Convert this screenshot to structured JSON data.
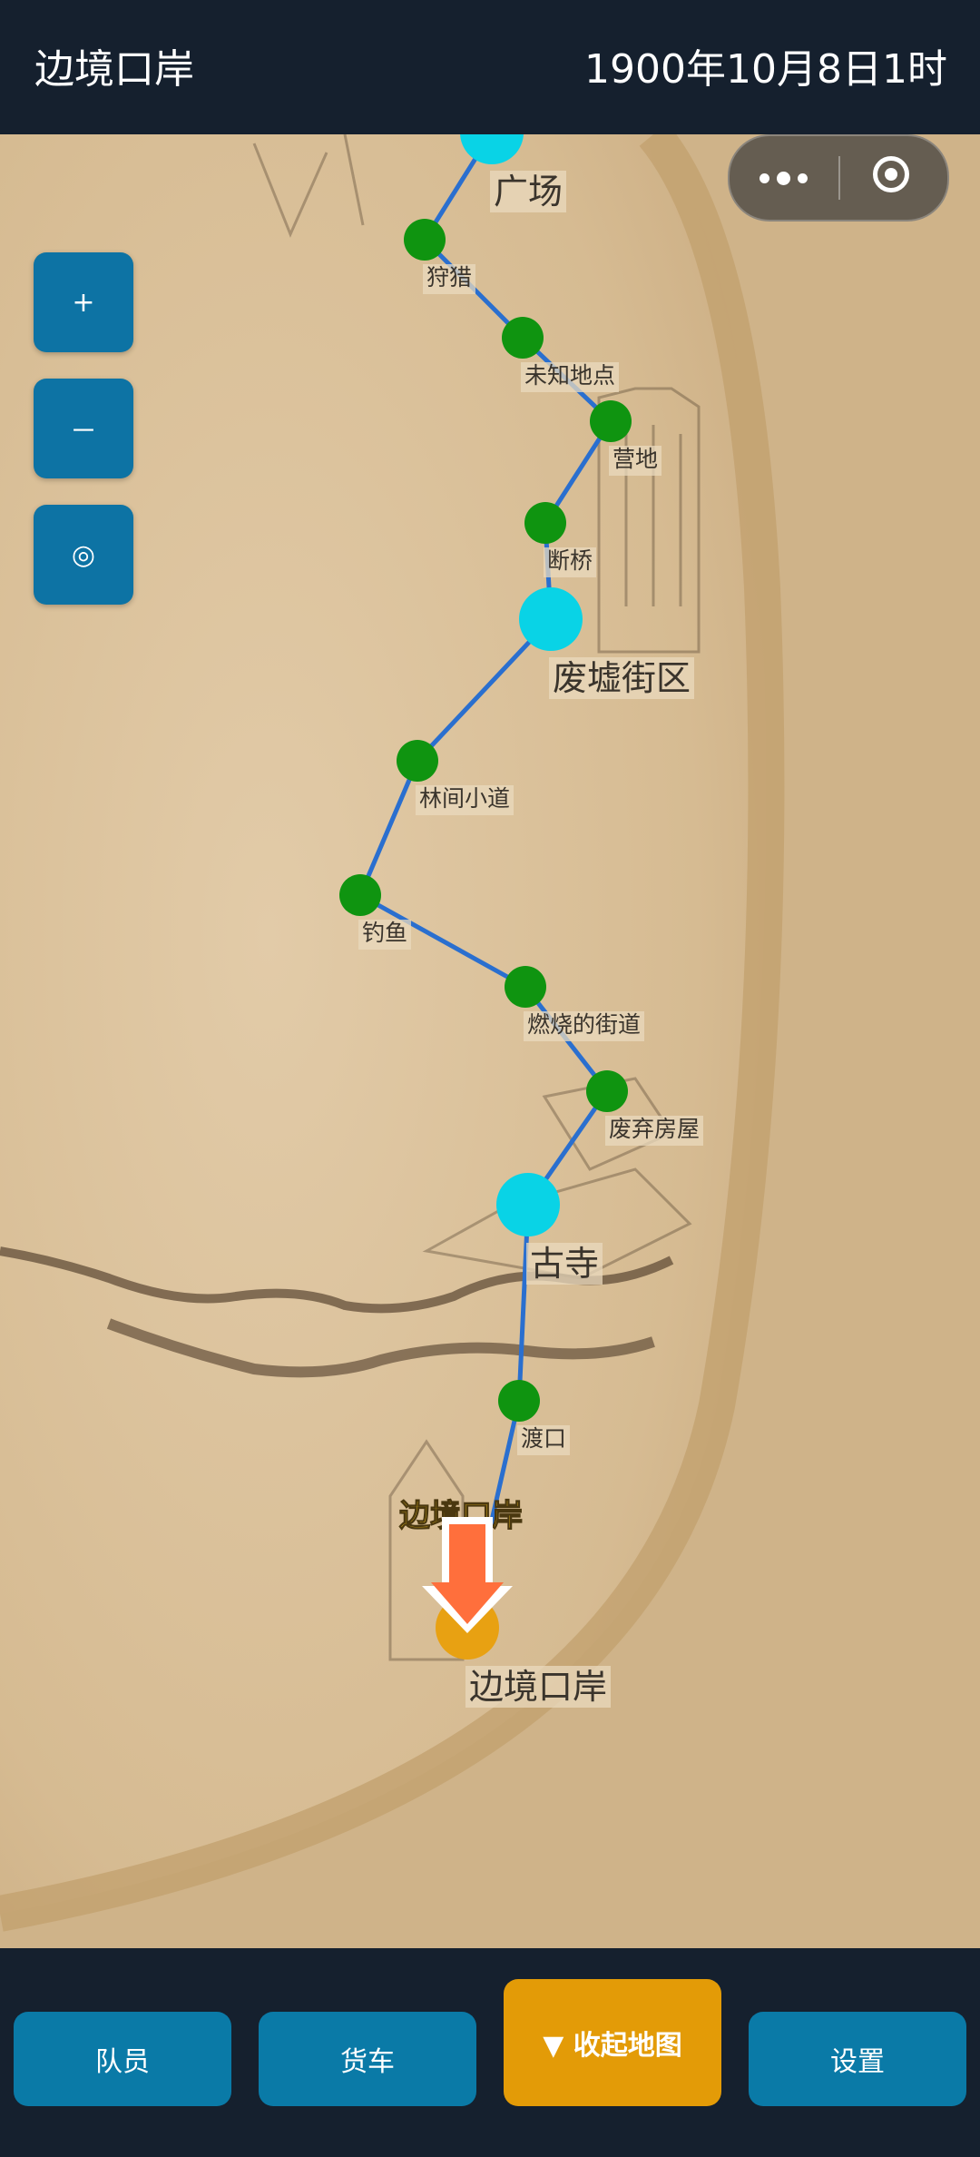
{
  "header": {
    "title": "边境口岸",
    "datetime": "1900年10月8日1时"
  },
  "zoom_controls": {
    "zoom_in": "+",
    "zoom_out": "－",
    "locate": "◎"
  },
  "miniprogram": {
    "more_icon": "more-dots-icon",
    "close_icon": "target-close-icon"
  },
  "map": {
    "route_color": "#2a6fcf",
    "minor_node_color": "#0f9410",
    "major_node_color": "#09d3e6",
    "current_node_color": "#e8a112",
    "nodes": [
      {
        "label": "广场",
        "type": "major"
      },
      {
        "label": "狩猎",
        "type": "minor"
      },
      {
        "label": "未知地点",
        "type": "minor"
      },
      {
        "label": "营地",
        "type": "minor"
      },
      {
        "label": "断桥",
        "type": "minor"
      },
      {
        "label": "废墟街区",
        "type": "major"
      },
      {
        "label": "林间小道",
        "type": "minor"
      },
      {
        "label": "钓鱼",
        "type": "minor"
      },
      {
        "label": "燃烧的街道",
        "type": "minor"
      },
      {
        "label": "废弃房屋",
        "type": "minor"
      },
      {
        "label": "古寺",
        "type": "major"
      },
      {
        "label": "渡口",
        "type": "minor"
      },
      {
        "label": "边境口岸",
        "type": "current"
      }
    ],
    "current_location_tag": "边境口岸",
    "current_marker_icon": "down-arrow-icon"
  },
  "bottom_nav": {
    "members": "队员",
    "truck": "货车",
    "collapse_map": "▼ 收起地图",
    "settings": "设置"
  }
}
